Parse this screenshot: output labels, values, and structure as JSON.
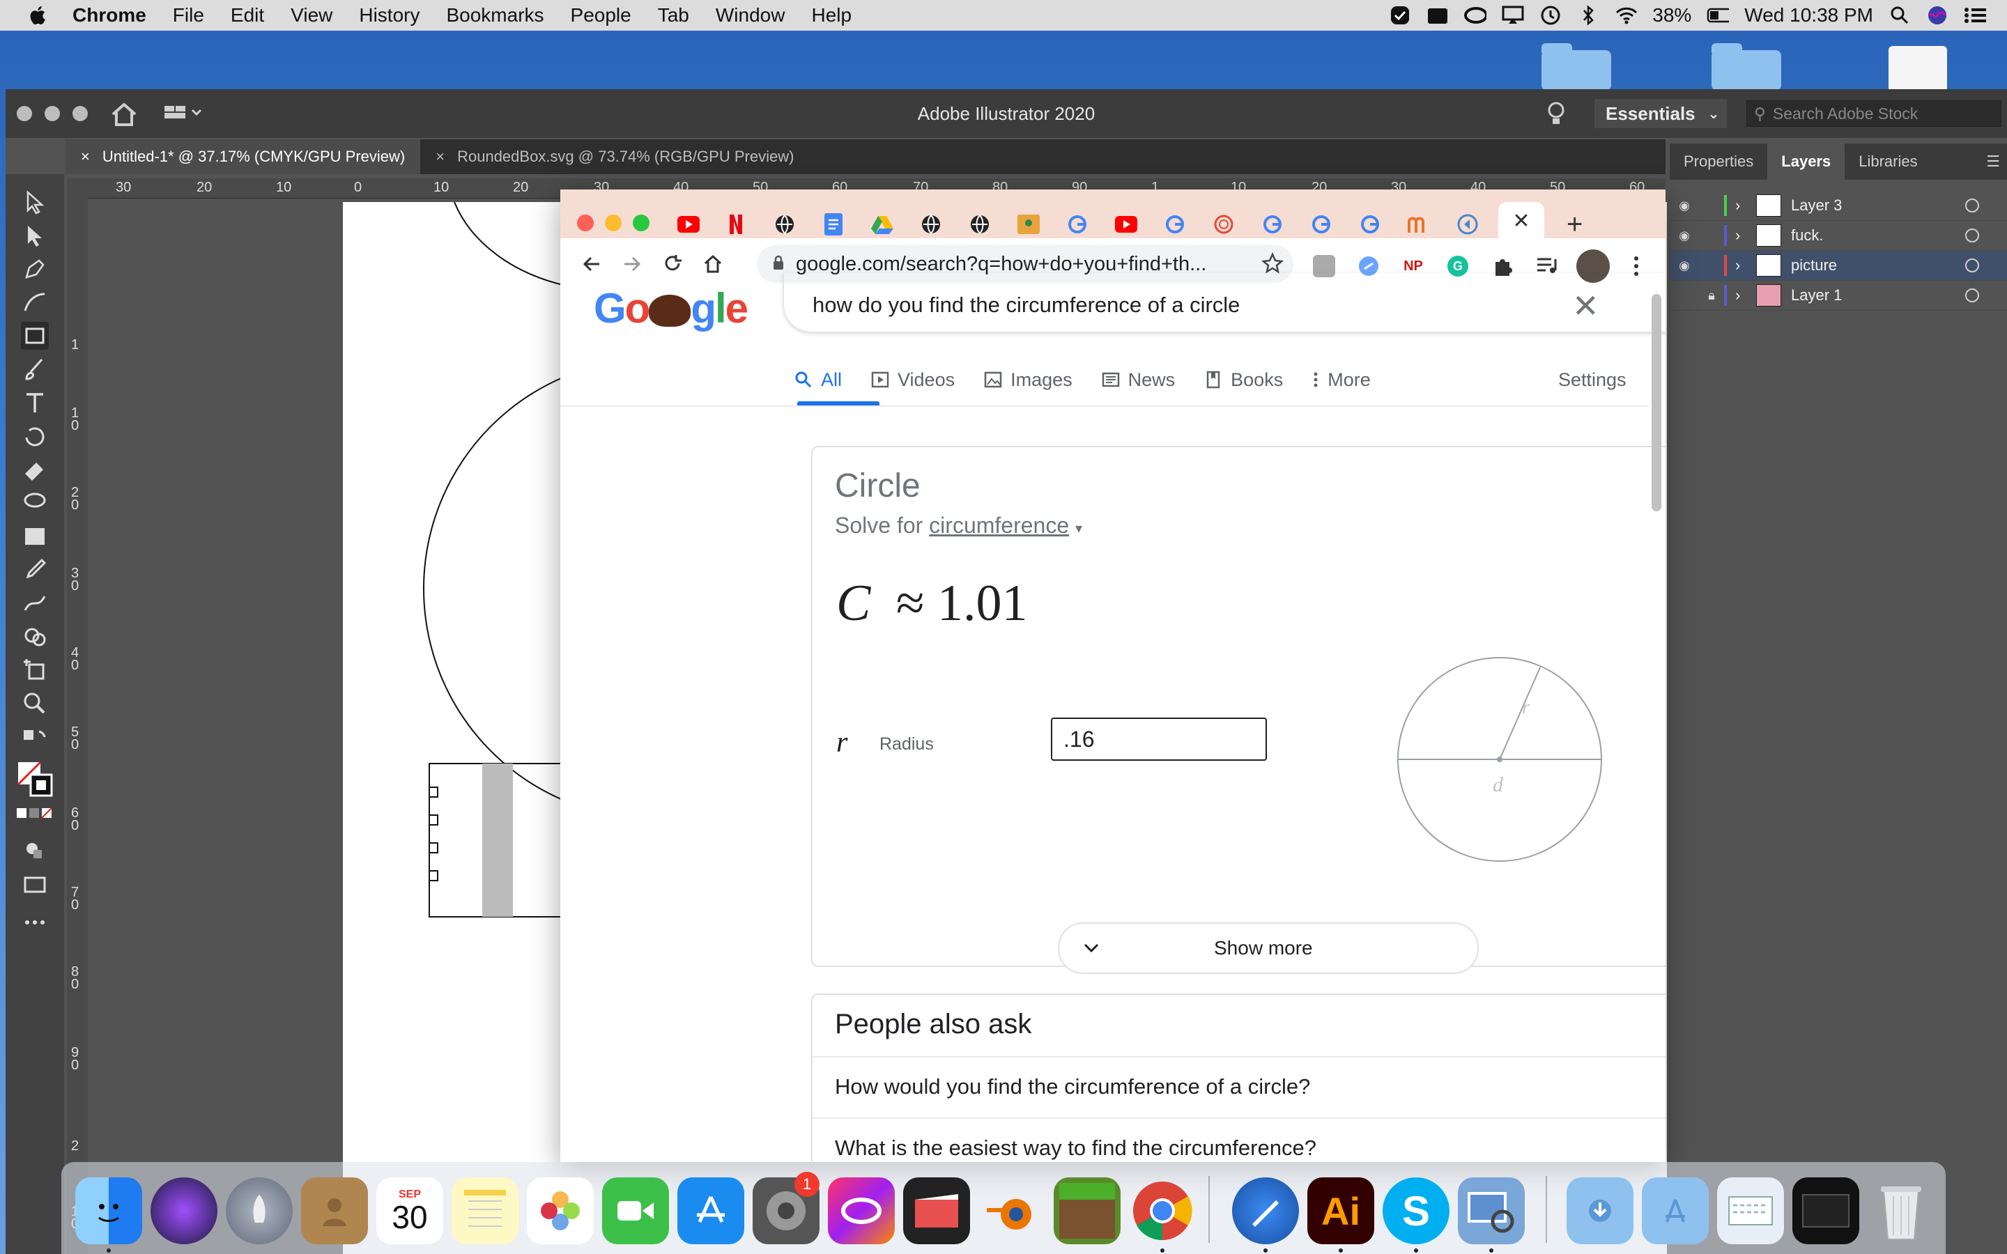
{
  "menubar": {
    "app": "Chrome",
    "items": [
      "File",
      "Edit",
      "View",
      "History",
      "Bookmarks",
      "People",
      "Tab",
      "Window",
      "Help"
    ],
    "battery": "38%",
    "clock": "Wed 10:38 PM"
  },
  "illustrator": {
    "title": "Adobe Illustrator 2020",
    "workspace": "Essentials",
    "stock_search_placeholder": "Search Adobe Stock",
    "doc_tabs": [
      {
        "label": "Untitled-1* @ 37.17% (CMYK/GPU Preview)"
      },
      {
        "label": "RoundedBox.svg @ 73.74% (RGB/GPU Preview)"
      }
    ],
    "ruler_top": [
      "30",
      "20",
      "10",
      "0",
      "10",
      "20",
      "30",
      "40",
      "50",
      "60",
      "70",
      "80",
      "90",
      "1",
      "10",
      "20",
      "30",
      "40",
      "50",
      "60"
    ],
    "ruler_left": [
      "1",
      "1 0",
      "2 0",
      "3 0",
      "4 0",
      "5 0",
      "6 0",
      "7 0",
      "8 0",
      "9 0",
      "2",
      "1 0"
    ],
    "panel_tabs": [
      "Properties",
      "Layers",
      "Libraries"
    ],
    "layers": [
      {
        "name": "Layer 3",
        "color": "#4bd14b"
      },
      {
        "name": "fuck.",
        "color": "#5a5ad8"
      },
      {
        "name": "picture",
        "color": "#e04848"
      },
      {
        "name": "Layer 1",
        "color": "#5a5ad8"
      }
    ]
  },
  "chrome": {
    "url": "google.com/search?q=how+do+you+find+th...",
    "extension_np": "NP"
  },
  "google": {
    "query": "how do you find the circumference of a circle",
    "tabs": [
      "All",
      "Videos",
      "Images",
      "News",
      "Books",
      "More"
    ],
    "settings": "Settings",
    "calc": {
      "title": "Circle",
      "solve_prefix": "Solve for",
      "solve_var": "circumference",
      "result_symbol": "C",
      "result_op": "≈",
      "result_value": "1.01",
      "var_symbol": "r",
      "var_label": "Radius",
      "input_value": ".16",
      "diagram_r": "r",
      "diagram_d": "d",
      "show_more": "Show more"
    },
    "paa": {
      "title": "People also ask",
      "questions": [
        "How would you find the circumference of a circle?",
        "What is the easiest way to find the circumference?"
      ]
    }
  },
  "dock": {
    "calendar_month": "SEP",
    "calendar_day": "30",
    "settings_badge": "1",
    "illustrator_label": "Ai",
    "skype_label": "S"
  }
}
